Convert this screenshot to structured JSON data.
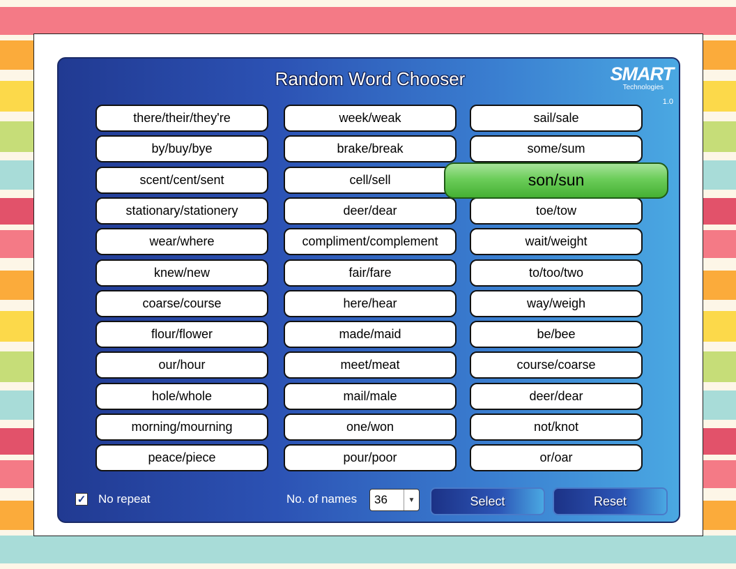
{
  "app": {
    "title": "Random Word Chooser",
    "logo": "SMART",
    "logo_sub": "Technologies",
    "version": "1.0"
  },
  "words": {
    "col1": [
      "there/their/they're",
      "by/buy/bye",
      "scent/cent/sent",
      "stationary/stationery",
      "wear/where",
      "knew/new",
      "coarse/course",
      "flour/flower",
      "our/hour",
      "hole/whole",
      "morning/mourning",
      "peace/piece"
    ],
    "col2": [
      "week/weak",
      "brake/break",
      "cell/sell",
      "deer/dear",
      "compliment/complement",
      "fair/fare",
      "here/hear",
      "made/maid",
      "meet/meat",
      "mail/male",
      "one/won",
      "pour/poor"
    ],
    "col3": [
      "sail/sale",
      "some/sum",
      "son/sun",
      "toe/tow",
      "wait/weight",
      "to/too/two",
      "way/weigh",
      "be/bee",
      "course/coarse",
      "deer/dear",
      "not/knot",
      "or/oar"
    ]
  },
  "selected_word": "son/sun",
  "controls": {
    "no_repeat_label": "No repeat",
    "no_repeat_checked": true,
    "no_of_names_label": "No. of names",
    "no_of_names_value": "36",
    "select_label": "Select",
    "reset_label": "Reset"
  },
  "colors": {
    "accent_green": "#6ccd5a",
    "panel_blue": "#2c52b4"
  }
}
